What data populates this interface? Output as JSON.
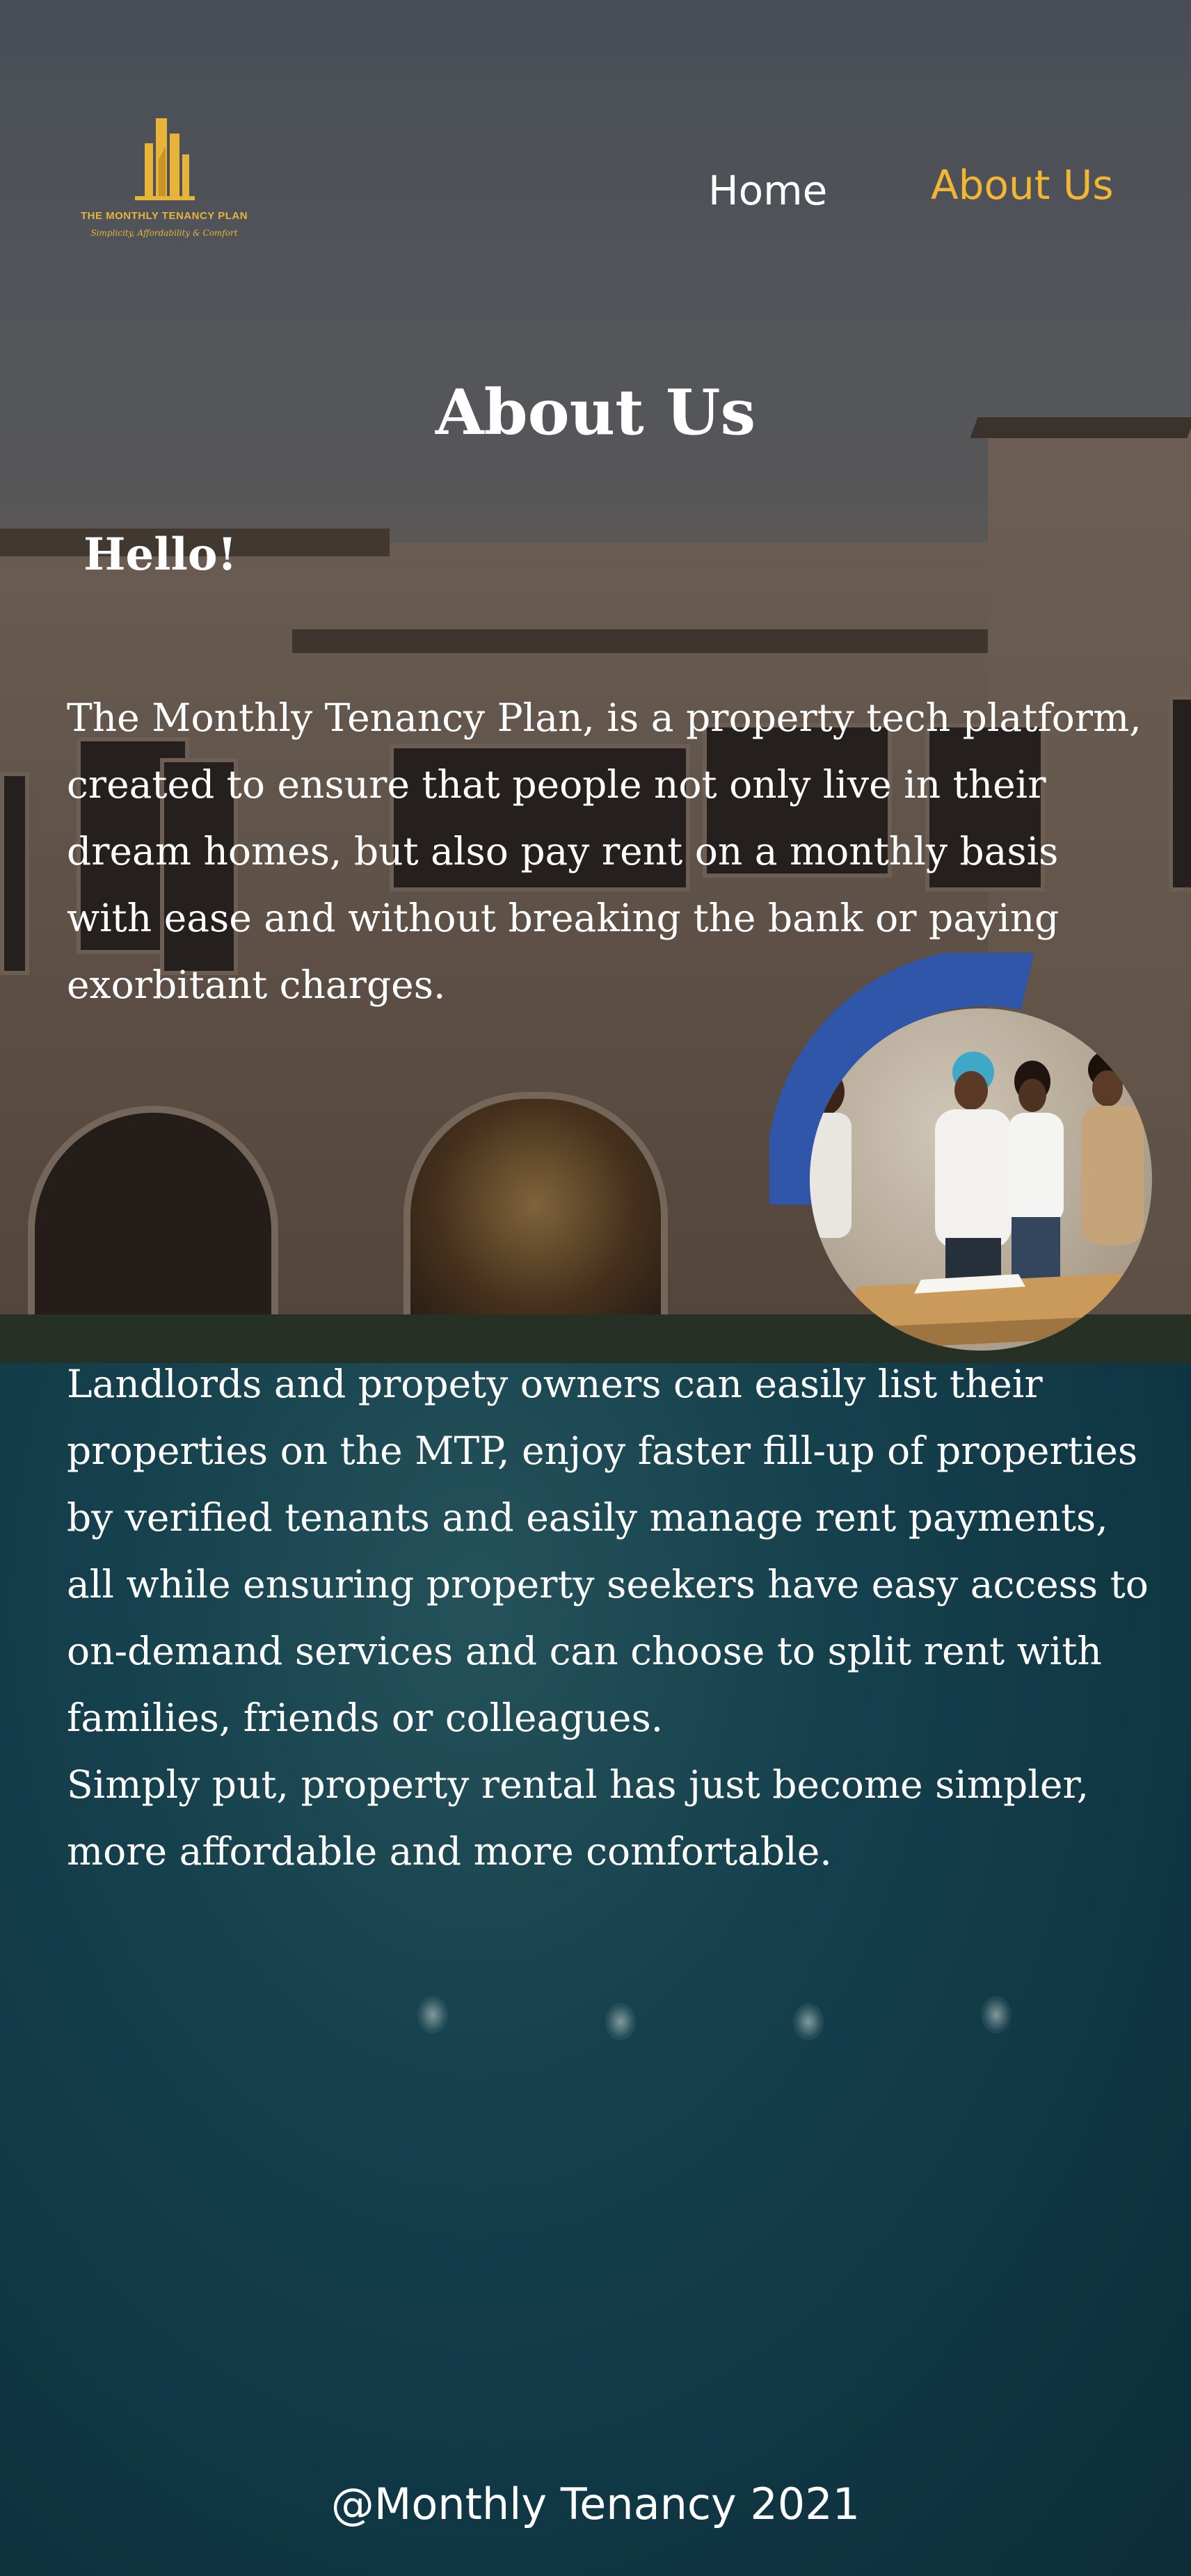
{
  "brand": {
    "name": "THE MONTHLY TENANCY PLAN",
    "tagline": "Simplicity, Affordability & Comfort",
    "logo_color": "#e8b339"
  },
  "nav": {
    "items": [
      {
        "label": "Home",
        "active": false
      },
      {
        "label": "About Us",
        "active": true
      }
    ],
    "active_color": "#f2b632"
  },
  "main": {
    "title": "About Us",
    "greeting": "Hello!",
    "paragraph1": "The Monthly Tenancy Plan, is a property tech platform, created to ensure that people not only live in their dream homes, but also pay rent on a monthly basis with ease and without breaking the bank or paying exorbitant charges.",
    "paragraph2": "Landlords and propety owners can easily list their properties on the MTP, enjoy faster fill-up of properties by verified tenants and easily manage rent payments, all while ensuring property seekers have easy access to on-demand services and can choose to split rent with families, friends or colleagues.",
    "paragraph3": "Simply put, property rental has just become simpler, more affordable and more comfortable.",
    "accent_color": "#2f56a8"
  },
  "footer": {
    "text": "@Monthly Tenancy 2021"
  }
}
